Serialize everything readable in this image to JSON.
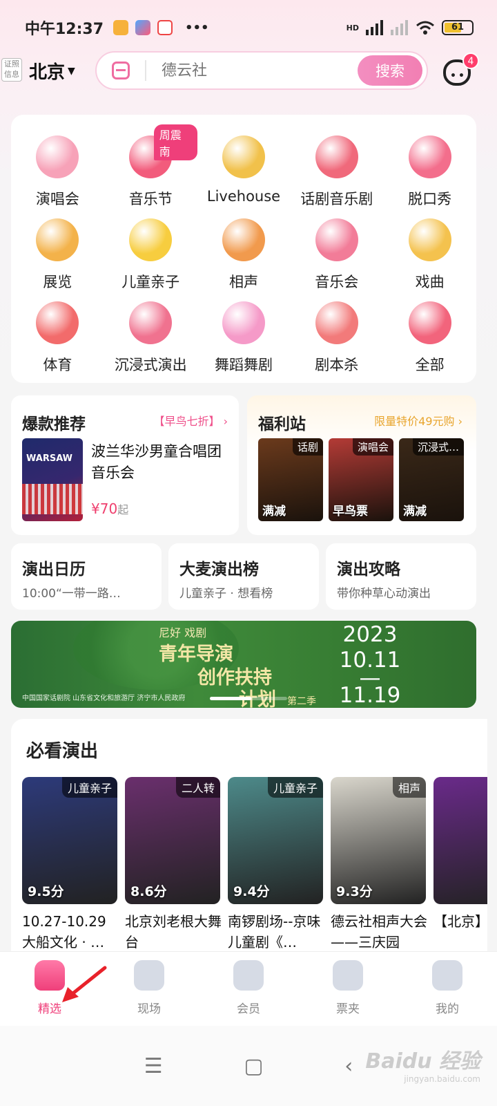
{
  "status_bar": {
    "time": "中午12:37",
    "battery": "61",
    "network": "HD",
    "more": "•••"
  },
  "header": {
    "cert_label": "证照信息",
    "city": "北京",
    "search_placeholder": "德云社",
    "search_button": "搜索",
    "message_badge": "4"
  },
  "categories": [
    {
      "label": "演唱会",
      "icon": "microphone-icon",
      "color": "#f7a2b8"
    },
    {
      "label": "音乐节",
      "icon": "music-note-icon",
      "color": "#f25c7c",
      "tag": "周震南"
    },
    {
      "label": "Livehouse",
      "icon": "guitar-icon",
      "color": "#f1c14b"
    },
    {
      "label": "话剧音乐剧",
      "icon": "stage-curtain-icon",
      "color": "#f0697b"
    },
    {
      "label": "脱口秀",
      "icon": "lips-icon",
      "color": "#f36e8c"
    },
    {
      "label": "展览",
      "icon": "picture-frame-icon",
      "color": "#f3b24a"
    },
    {
      "label": "儿童亲子",
      "icon": "duck-icon",
      "color": "#f7cd3f"
    },
    {
      "label": "相声",
      "icon": "fan-scroll-icon",
      "color": "#f19a4d"
    },
    {
      "label": "音乐会",
      "icon": "piano-icon",
      "color": "#f27c98"
    },
    {
      "label": "戏曲",
      "icon": "folding-fan-icon",
      "color": "#f4c24e"
    },
    {
      "label": "体育",
      "icon": "soccer-ball-icon",
      "color": "#f26b6b"
    },
    {
      "label": "沉浸式演出",
      "icon": "vr-headset-icon",
      "color": "#f0728f"
    },
    {
      "label": "舞蹈舞剧",
      "icon": "dancer-icon",
      "color": "#f59ac8"
    },
    {
      "label": "剧本杀",
      "icon": "detective-hat-icon",
      "color": "#f27a7a"
    },
    {
      "label": "全部",
      "icon": "grid-all-icon",
      "color": "#f2647c"
    }
  ],
  "hot": {
    "title": "爆款推荐",
    "promo": "【早鸟七折】",
    "poster_text": "WARSAW",
    "name": "波兰华沙男童合唱团音乐会",
    "price": "¥70",
    "price_suffix": "起"
  },
  "fuli": {
    "title": "福利站",
    "promo": "限量特价49元购",
    "items": [
      {
        "tag": "话剧",
        "label": "满减",
        "bg": "#6b3a1c"
      },
      {
        "tag": "演唱会",
        "label": "早鸟票",
        "bg": "#b43b36"
      },
      {
        "tag": "沉浸式…",
        "label": "满减",
        "bg": "#3a2818"
      }
    ]
  },
  "tiles": [
    {
      "title": "演出日历",
      "sub": "10:00“一带一路…"
    },
    {
      "title": "大麦演出榜",
      "sub": "儿童亲子 · 想看榜"
    },
    {
      "title": "演出攻略",
      "sub": "带你种草心动演出"
    }
  ],
  "banner": {
    "brand": "尼好  戏剧",
    "line1": "青年导演",
    "line2": "创作扶持",
    "line3": "计划",
    "season": "第二季",
    "year": "2023",
    "start": "10.11",
    "dash": "—",
    "end": "11.19",
    "org": "中国国家话剧院    山东省文化和旅游厅    济宁市人民政府"
  },
  "must": {
    "title": "必看演出",
    "shows": [
      {
        "tag": "儿童亲子",
        "score": "9.5分",
        "name": "10.27-10.29 大船文化 · …",
        "bg": "#2d3a7a"
      },
      {
        "tag": "二人转",
        "score": "8.6分",
        "name": "北京刘老根大舞台",
        "bg": "#6a2f6d"
      },
      {
        "tag": "儿童亲子",
        "score": "9.4分",
        "name": "南锣剧场--京味儿童剧《…",
        "bg": "#4d8a8a"
      },
      {
        "tag": "相声",
        "score": "9.3分",
        "name": "德云社相声大会——三庆园",
        "bg": "#d9d6cc"
      },
      {
        "tag": "",
        "score": "",
        "name": "【北京】全新巨",
        "bg": "#6a2a8a"
      }
    ]
  },
  "tabs": [
    {
      "label": "精选",
      "icon": "home-icon",
      "active": true
    },
    {
      "label": "现场",
      "icon": "live-icon"
    },
    {
      "label": "会员",
      "icon": "vip-icon"
    },
    {
      "label": "票夹",
      "icon": "ticket-icon"
    },
    {
      "label": "我的",
      "icon": "profile-icon"
    }
  ],
  "nav": {
    "menu": "☰",
    "home": "▢",
    "back": "‹"
  },
  "watermark": {
    "brand": "Baidu 经验",
    "url": "jingyan.baidu.com"
  }
}
